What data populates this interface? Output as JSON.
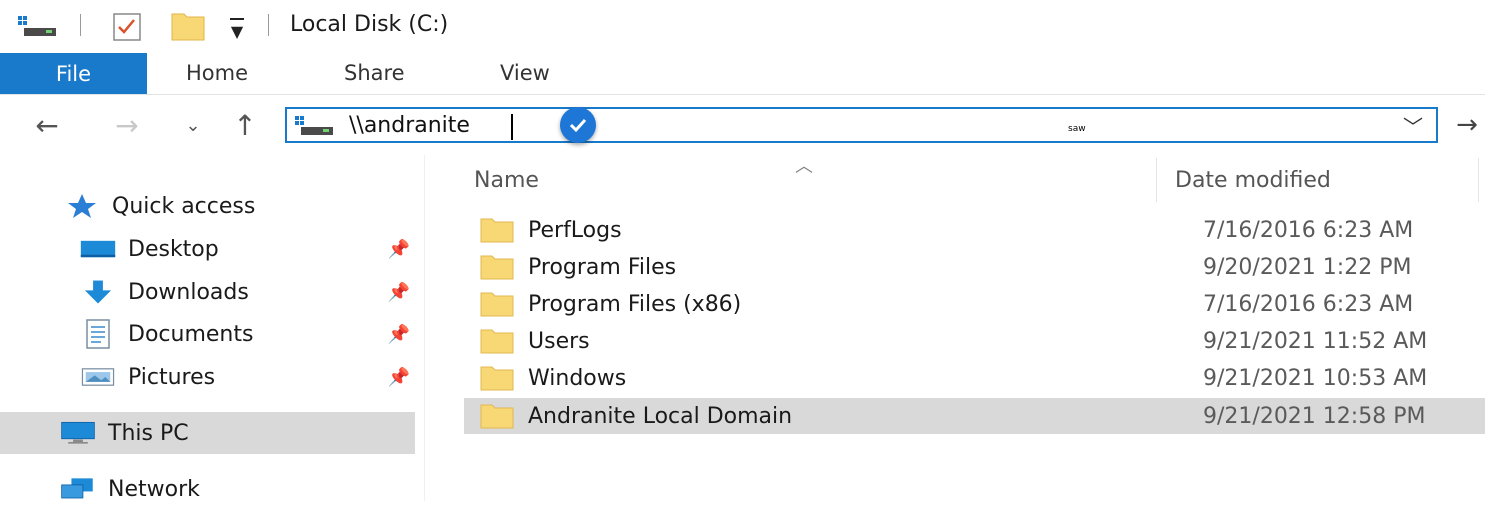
{
  "window": {
    "title": "Local Disk (C:)"
  },
  "ribbon": {
    "tabs": [
      "File",
      "Home",
      "Share",
      "View"
    ]
  },
  "address_bar": {
    "value": "\\\\andranite",
    "stray_text": "saw"
  },
  "nav_pane": {
    "quick_access": "Quick access",
    "pinned": [
      {
        "label": "Desktop",
        "icon": "desktop-icon"
      },
      {
        "label": "Downloads",
        "icon": "downloads-icon"
      },
      {
        "label": "Documents",
        "icon": "documents-icon"
      },
      {
        "label": "Pictures",
        "icon": "pictures-icon"
      }
    ],
    "this_pc": "This PC",
    "network": "Network"
  },
  "file_list": {
    "columns": {
      "name": "Name",
      "date_modified": "Date modified"
    },
    "rows": [
      {
        "name": "PerfLogs",
        "date": "7/16/2016 6:23 AM"
      },
      {
        "name": "Program Files",
        "date": "9/20/2021 1:22 PM"
      },
      {
        "name": "Program Files (x86)",
        "date": "7/16/2016 6:23 AM"
      },
      {
        "name": "Users",
        "date": "9/21/2021 11:52 AM"
      },
      {
        "name": "Windows",
        "date": "9/21/2021 10:53 AM"
      },
      {
        "name": "Andranite Local Domain",
        "date": "9/21/2021 12:58 PM"
      }
    ]
  },
  "colors": {
    "accent": "#1979ca",
    "selection": "#d9d9d9",
    "folder": "#f8d775"
  }
}
